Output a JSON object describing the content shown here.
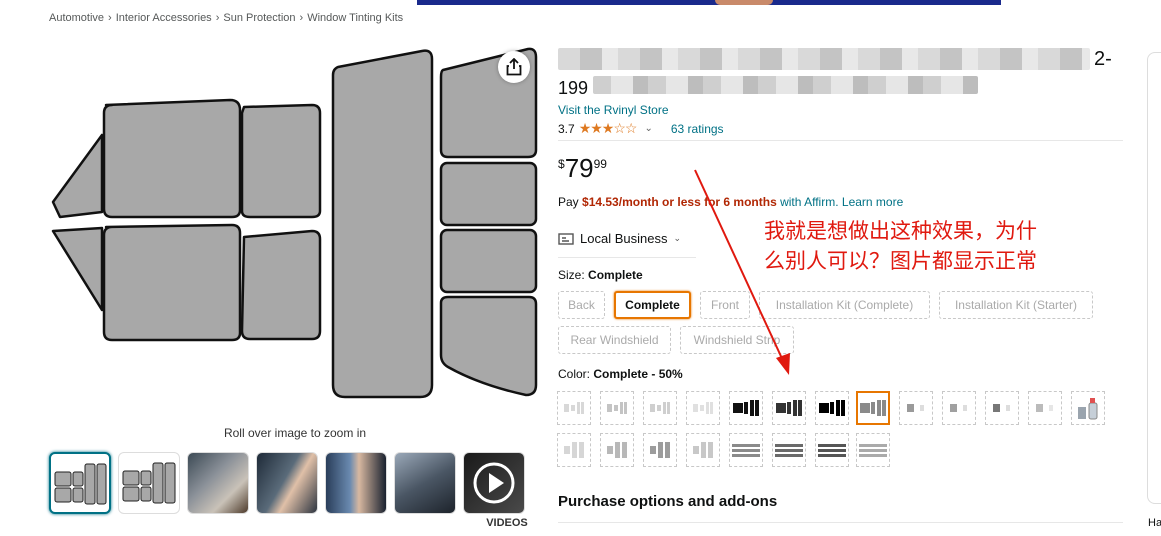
{
  "breadcrumb": {
    "items": [
      "Automotive",
      "Interior Accessories",
      "Sun Protection",
      "Window Tinting Kits"
    ],
    "separator": "›"
  },
  "gallery": {
    "zoom_hint": "Roll over image to zoom in",
    "videos_label": "VIDEOS"
  },
  "product": {
    "title_visible_tail": "2-",
    "title_visible_prefix": "199",
    "store_link": "Visit the Rvinyl Store",
    "rating_value": "3.7",
    "rating_count": "63 ratings",
    "price": {
      "symbol": "$",
      "whole": "79",
      "fraction": "99"
    },
    "affirm": {
      "prefix": "Pay",
      "amount": "$14.53/month or less for 6 months",
      "with": "with Affirm.",
      "learn_more": "Learn more"
    },
    "local_business": "Local Business",
    "size": {
      "label": "Size:",
      "selected": "Complete",
      "options": [
        "Back",
        "Complete",
        "Front",
        "Installation Kit (Complete)",
        "Installation Kit (Starter)",
        "Rear Windshield",
        "Windshield Strip"
      ]
    },
    "color": {
      "label": "Color:",
      "selected": "Complete - 50%"
    },
    "purchase_heading": "Purchase options and add-ons"
  },
  "annotation": {
    "line1": "我就是想做出这种效果，为什",
    "line2": "么别人可以？图片都显示正常",
    "color": "#e0190f"
  },
  "edge_text": "Ha",
  "colors": {
    "link": "#007185",
    "price_red": "#b12704",
    "star": "#de7921",
    "selected_border": "#e77600",
    "tint_fill": "#a8a8a8"
  }
}
